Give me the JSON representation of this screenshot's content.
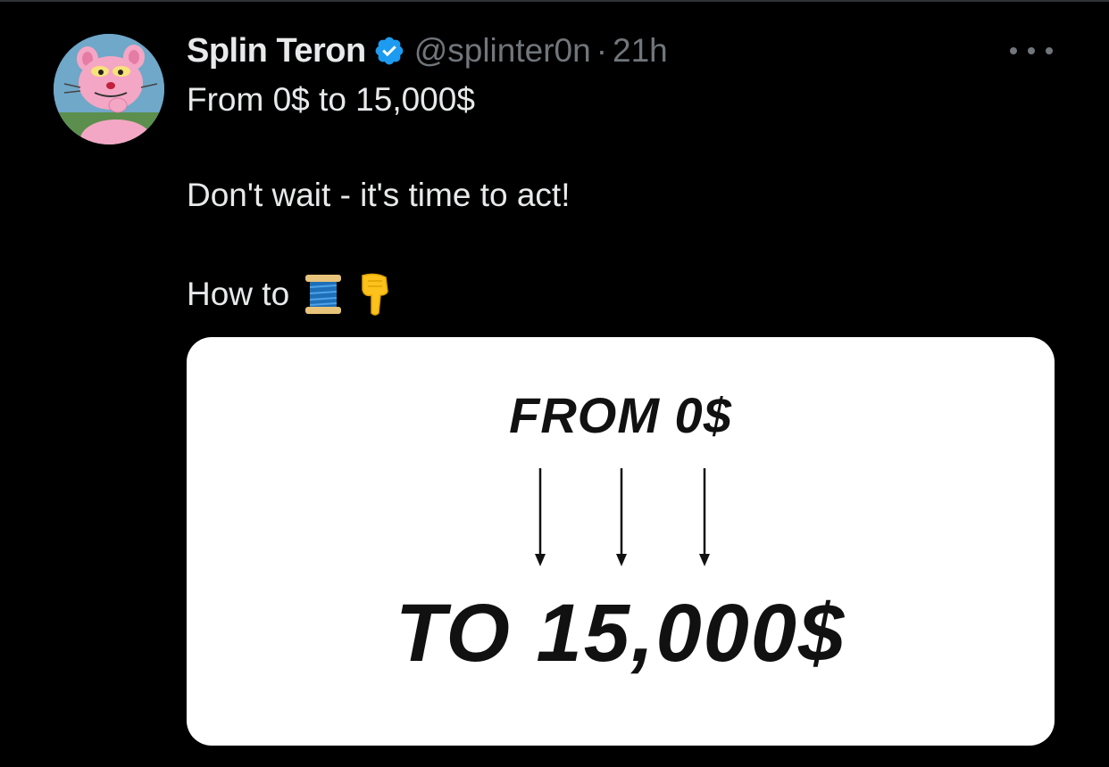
{
  "tweet": {
    "display_name": "Splin Teron",
    "handle": "@splinter0n",
    "separator": "·",
    "time": "21h",
    "lines": [
      "From 0$ to 15,000$",
      "Don't wait - it's time to act!",
      "How to"
    ],
    "emojis": [
      "thread-spool-icon",
      "pointing-down-hand-icon"
    ]
  },
  "media": {
    "top_text": "FROM 0$",
    "bottom_text": "TO 15,000$"
  },
  "colors": {
    "background": "#000000",
    "text": "#e7e9ea",
    "muted": "#71767b",
    "verified": "#1d9bf0",
    "card": "#ffffff"
  }
}
